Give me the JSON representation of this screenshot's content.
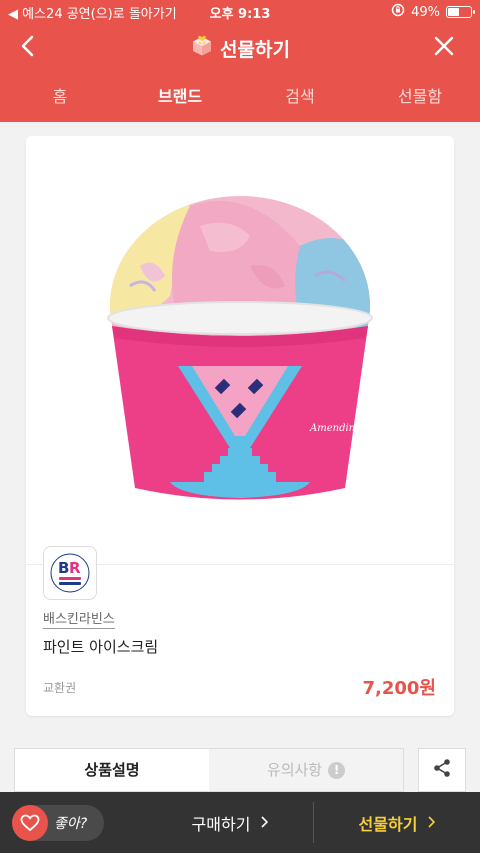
{
  "status_bar": {
    "back_to_app": "◀ 예스24 공연(으)로 돌아가기",
    "time": "오후 9:13",
    "battery": "49%",
    "battery_level": 0.49
  },
  "header": {
    "title": "선물하기"
  },
  "tabs": [
    {
      "label": "홈",
      "active": false
    },
    {
      "label": "브랜드",
      "active": true
    },
    {
      "label": "검색",
      "active": false
    },
    {
      "label": "선물함",
      "active": false
    }
  ],
  "product": {
    "brand": "배스킨라빈스",
    "name": "파인트 아이스크림",
    "type": "교환권",
    "price": "7,200원",
    "cup_signature": "Amendini"
  },
  "detail_tabs": [
    {
      "label": "상품설명",
      "active": true
    },
    {
      "label": "유의사항",
      "active": false
    }
  ],
  "bottom_bar": {
    "like_label": "좋아?",
    "buy_label": "구매하기",
    "gift_label": "선물하기"
  },
  "colors": {
    "accent": "#e8534b",
    "gift_yellow": "#f5d03b",
    "bottom_bar": "#333333"
  }
}
